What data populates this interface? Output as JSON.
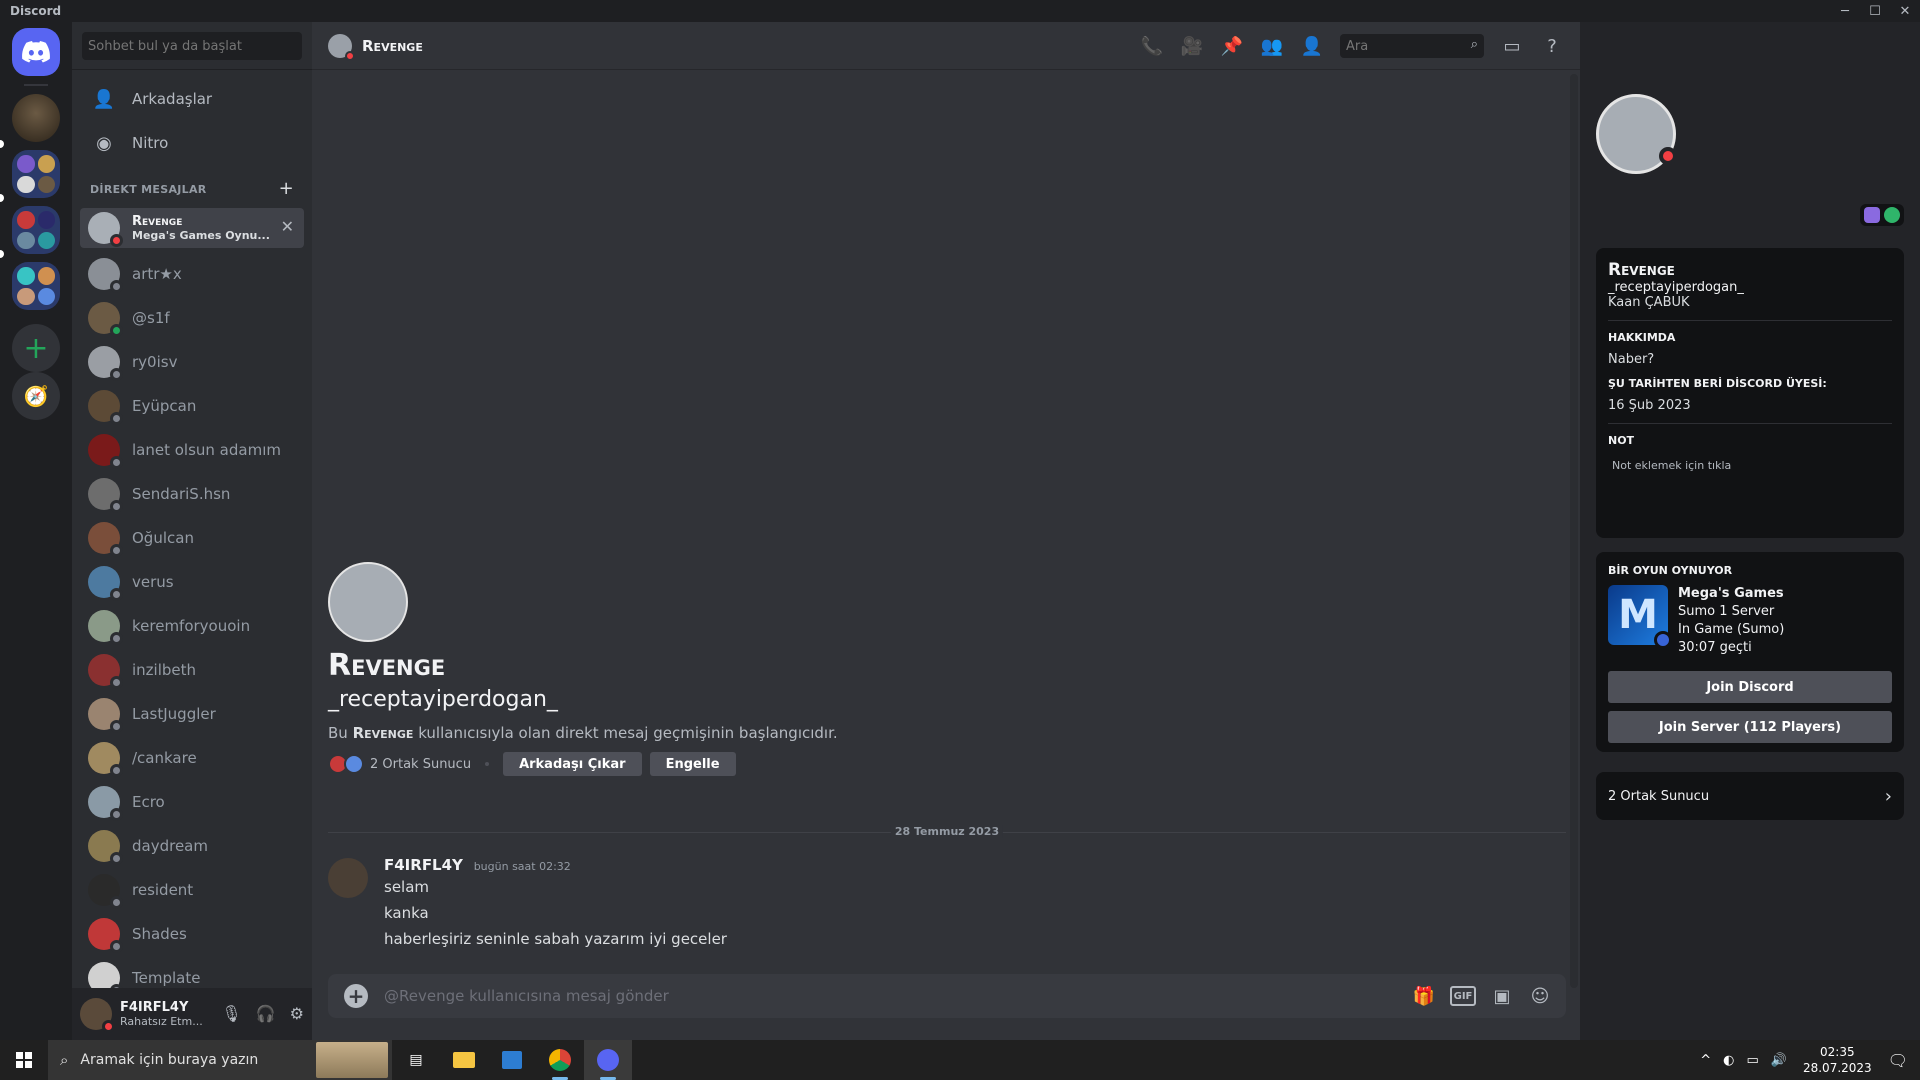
{
  "window": {
    "title": "Discord",
    "controls": [
      "─",
      "☐",
      "✕"
    ]
  },
  "rail": {
    "colors": {
      "home": "#5865f2",
      "add": "#23a55a"
    }
  },
  "sidebar": {
    "search_placeholder": "Sohbet bul ya da başlat",
    "nav": [
      {
        "label": "Arkadaşlar",
        "icon": "friends-icon"
      },
      {
        "label": "Nitro",
        "icon": "nitro-icon"
      }
    ],
    "dm_header": "DİREKT MESAJLAR",
    "dms": [
      {
        "name": "Revenge",
        "sub": "Mega's Games Oynu...",
        "status": "dnd",
        "active": true,
        "color": "#a9afb6"
      },
      {
        "name": "artr★x",
        "status": "off",
        "color": "#8a8f96"
      },
      {
        "name": "@s1f",
        "status": "on",
        "color": "#6b5a44"
      },
      {
        "name": "ry0isv",
        "status": "off",
        "color": "#9a9ea4"
      },
      {
        "name": "Eyüpcan",
        "status": "off",
        "color": "#5c4a36"
      },
      {
        "name": "lanet olsun adamım",
        "status": "off",
        "color": "#7a1a1a"
      },
      {
        "name": "SendariS.hsn",
        "status": "off",
        "color": "#6d6d6d"
      },
      {
        "name": "Oğulcan",
        "status": "off",
        "color": "#7a4e3a"
      },
      {
        "name": "verus",
        "status": "off",
        "color": "#4d7aa0"
      },
      {
        "name": "keremforyouoin",
        "status": "off",
        "color": "#8a9a88"
      },
      {
        "name": "inzilbeth",
        "status": "off",
        "color": "#8a3030"
      },
      {
        "name": "LastJuggler",
        "status": "off",
        "color": "#9a8470"
      },
      {
        "name": "/cankare",
        "status": "off",
        "color": "#a08a60"
      },
      {
        "name": "Ecro",
        "status": "off",
        "color": "#8a9aa6"
      },
      {
        "name": "daydream",
        "status": "off",
        "color": "#8a7a50"
      },
      {
        "name": "resident",
        "status": "off",
        "color": "#2a2a2a"
      },
      {
        "name": "Shades",
        "status": "off",
        "color": "#c03838"
      },
      {
        "name": "Template",
        "status": "off",
        "color": "#d0d0d0"
      }
    ]
  },
  "user": {
    "name": "F4IRFL4Y",
    "status": "Rahatsız Etm..."
  },
  "chat": {
    "title": "Revenge",
    "search_placeholder": "Ara",
    "intro": {
      "name": "Revenge",
      "handle": "_receptayiperdogan_",
      "desc_prefix": "Bu ",
      "desc_name": "Revenge",
      "desc_suffix": " kullanıcısıyla olan direkt mesaj geçmişinin başlangıcıdır.",
      "mutual": "2 Ortak Sunucu",
      "remove_friend": "Arkadaşı Çıkar",
      "block": "Engelle"
    },
    "date_divider": "28 Temmuz 2023",
    "message": {
      "author": "F4IRFL4Y",
      "time": "bugün saat 02:32",
      "lines": [
        "selam",
        "kanka",
        "haberleşiriz seninle sabah yazarım iyi geceler"
      ]
    },
    "composer_placeholder": "@Revenge kullanıcısına mesaj gönder",
    "composer_gif": "GIF"
  },
  "profile": {
    "name": "Revenge",
    "handle": "_receptayiperdogan_",
    "real_name": "Kaan ÇABUK",
    "about_title": "HAKKIMDA",
    "about": "Naber?",
    "member_title": "ŞU TARİHTEN BERİ DİSCORD ÜYESİ:",
    "member_since": "16 Şub 2023",
    "note_title": "NOT",
    "note_placeholder": "Not eklemek için tıkla",
    "activity_title": "BİR OYUN OYNUYOR",
    "game": {
      "name": "Mega's Games",
      "line1": "Sumo 1 Server",
      "line2": "In Game (Sumo)",
      "line3": "30:07 geçti",
      "btn1": "Join Discord",
      "btn2": "Join Server (112 Players)"
    },
    "mutual": "2 Ortak Sunucu"
  },
  "taskbar": {
    "search_placeholder": "Aramak için buraya yazın",
    "time": "02:35",
    "date": "28.07.2023"
  }
}
